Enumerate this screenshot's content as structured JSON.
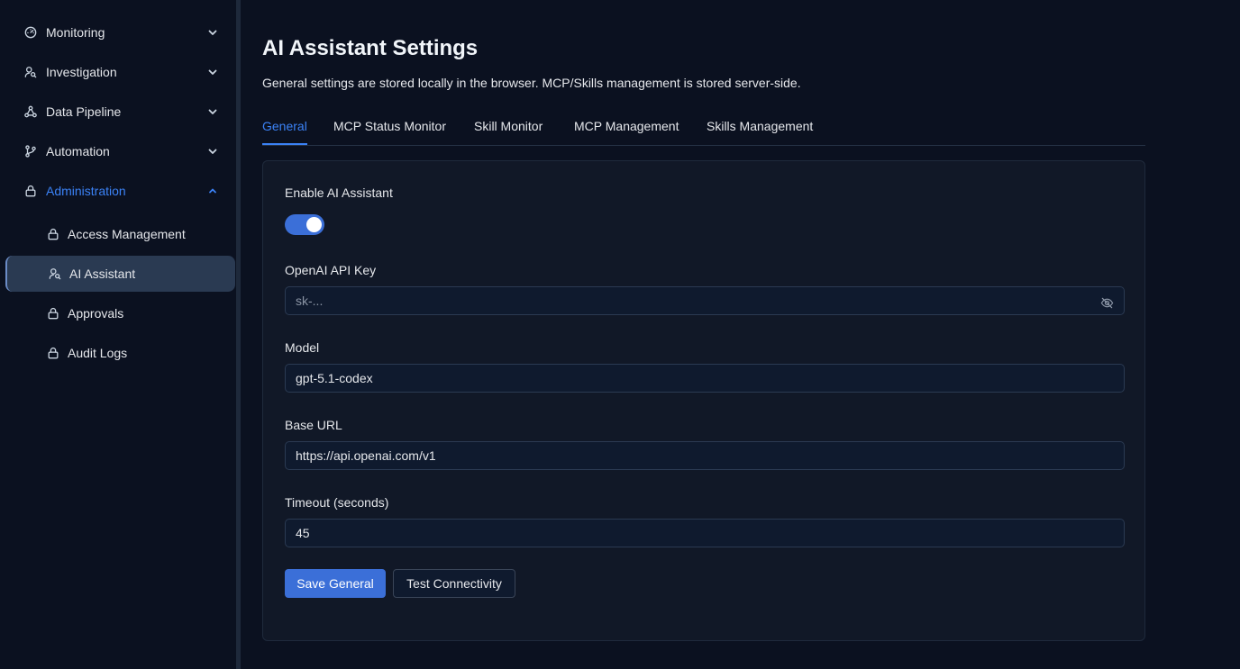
{
  "sidebar": {
    "groups": [
      {
        "label": "Monitoring",
        "icon": "gauge-icon",
        "expanded": false
      },
      {
        "label": "Investigation",
        "icon": "users-search-icon",
        "expanded": false
      },
      {
        "label": "Data Pipeline",
        "icon": "network-icon",
        "expanded": false
      },
      {
        "label": "Automation",
        "icon": "git-branch-icon",
        "expanded": false
      },
      {
        "label": "Administration",
        "icon": "lock-icon",
        "expanded": true
      }
    ],
    "admin_items": [
      {
        "label": "Access Management",
        "icon": "lock-icon"
      },
      {
        "label": "AI Assistant",
        "icon": "users-search-icon",
        "selected": true
      },
      {
        "label": "Approvals",
        "icon": "lock-icon"
      },
      {
        "label": "Audit Logs",
        "icon": "lock-icon"
      }
    ]
  },
  "page": {
    "title": "AI Assistant Settings",
    "description": "General settings are stored locally in the browser. MCP/Skills management is stored server-side."
  },
  "tabs": [
    {
      "label": "General",
      "active": true
    },
    {
      "label": "MCP Status Monitor"
    },
    {
      "label": "Skill Monitor"
    },
    {
      "label": "MCP Management"
    },
    {
      "label": "Skills Management"
    }
  ],
  "form": {
    "enable_label": "Enable AI Assistant",
    "enabled": true,
    "api_key_label": "OpenAI API Key",
    "api_key_placeholder": "sk-...",
    "api_key_value": "",
    "model_label": "Model",
    "model_value": "gpt-5.1-codex",
    "base_url_label": "Base URL",
    "base_url_value": "https://api.openai.com/v1",
    "timeout_label": "Timeout (seconds)",
    "timeout_value": "45",
    "save_label": "Save General",
    "test_label": "Test Connectivity"
  },
  "colors": {
    "accent": "#3b82f6",
    "background": "#0b1120",
    "card": "#111827"
  }
}
